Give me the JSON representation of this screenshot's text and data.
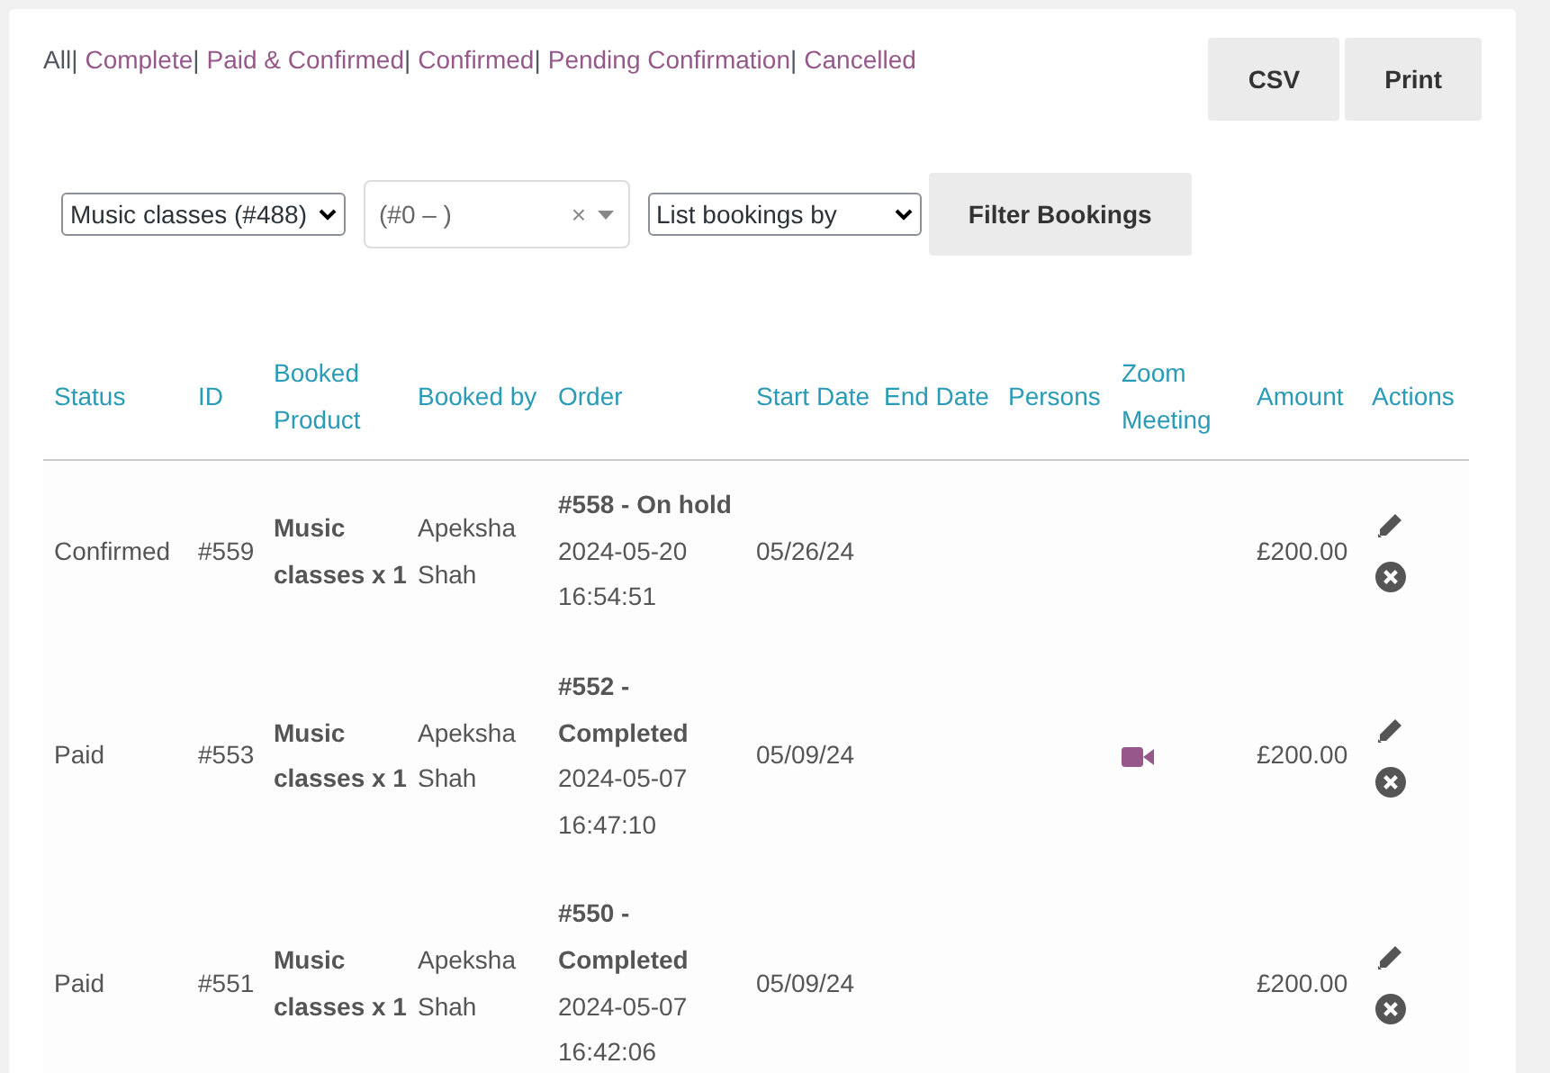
{
  "filters": [
    {
      "label": "All",
      "selected": true
    },
    {
      "label": "Complete",
      "selected": false
    },
    {
      "label": "Paid & Confirmed",
      "selected": false
    },
    {
      "label": "Confirmed",
      "selected": false
    },
    {
      "label": "Pending Confirmation",
      "selected": false
    },
    {
      "label": "Cancelled",
      "selected": false
    }
  ],
  "filter_separator": "|",
  "export_buttons": [
    "CSV",
    "Print"
  ],
  "product_select": {
    "value": "Music classes (#488)"
  },
  "resource_select": {
    "value": "(#0 – )",
    "clear": "×"
  },
  "list_by_select": {
    "value": "List bookings by"
  },
  "filter_button": "Filter Bookings",
  "table": {
    "columns": [
      "Status",
      "ID",
      "Booked Product",
      "Booked by",
      "Order",
      "Start Date",
      "End Date",
      "Persons",
      "Zoom Meeting",
      "Amount",
      "Actions"
    ],
    "rows": [
      {
        "status": "Confirmed",
        "id": "#559",
        "product": "Music classes x 1",
        "booked_by": "Apeksha Shah",
        "order": "#558 - On hold",
        "order_date": "2024-05-20 16:54:51",
        "start_date": "05/26/24",
        "zoom": false,
        "amount": "£200.00"
      },
      {
        "status": "Paid",
        "id": "#553",
        "product": "Music classes x 1",
        "booked_by": "Apeksha Shah",
        "order": "#552 - Completed",
        "order_date": "2024-05-07 16:47:10",
        "start_date": "05/09/24",
        "zoom": true,
        "amount": "£200.00"
      },
      {
        "status": "Paid",
        "id": "#551",
        "product": "Music classes x 1",
        "booked_by": "Apeksha Shah",
        "order": "#550 - Completed",
        "order_date": "2024-05-07 16:42:06",
        "start_date": "05/09/24",
        "zoom": false,
        "amount": "£200.00"
      }
    ]
  }
}
